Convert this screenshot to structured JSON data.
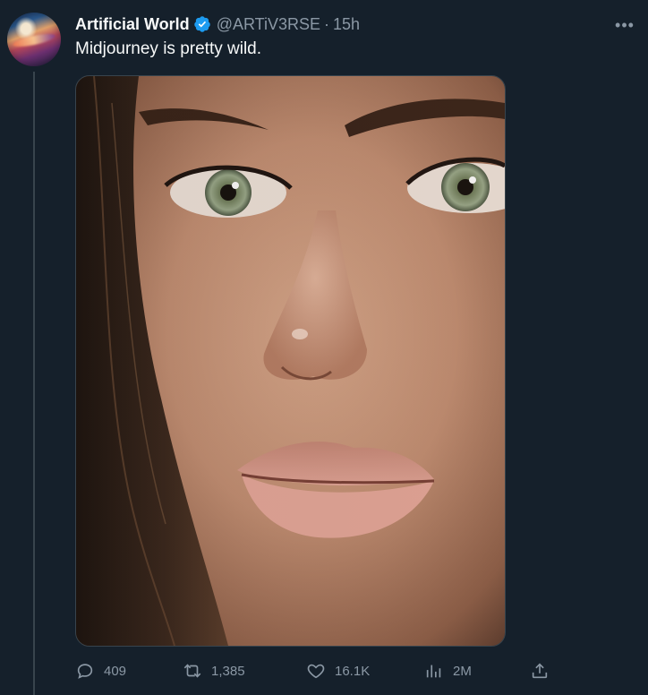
{
  "author": {
    "display_name": "Artificial World",
    "handle": "@ARTiV3RSE",
    "separator": "·",
    "time": "15h",
    "verified": true
  },
  "tweet": {
    "text": "Midjourney is pretty wild."
  },
  "more_icon": "more-horizontal-icon",
  "actions": {
    "reply_count": "409",
    "retweet_count": "1,385",
    "like_count": "16.1K",
    "views_count": "2M"
  },
  "colors": {
    "background": "#15202b",
    "text": "#f7f9f9",
    "muted": "#8b98a5",
    "verified": "#1d9bf0",
    "border": "#38444d"
  }
}
